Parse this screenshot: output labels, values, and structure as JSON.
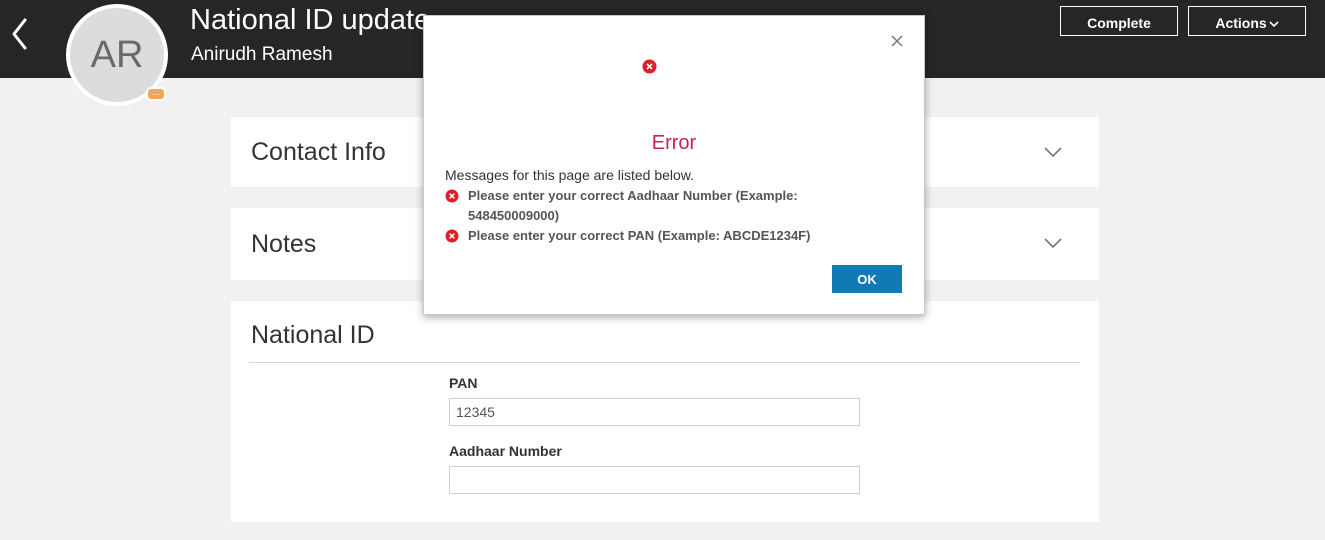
{
  "header": {
    "title": "National ID update",
    "subtitle": "Anirudh Ramesh",
    "avatar_initials": "AR",
    "avatar_badge": "…",
    "back_icon": "chevron-left-icon",
    "complete_label": "Complete",
    "actions_label": "Actions",
    "background_color": "#262626"
  },
  "sections": {
    "contact_title": "Contact Info",
    "notes_title": "Notes",
    "national_title": "National ID"
  },
  "form": {
    "pan_label": "PAN",
    "pan_value": "12345",
    "aadhaar_label": "Aadhaar Number",
    "aadhaar_value": ""
  },
  "dialog": {
    "title": "Error",
    "intro": "Messages for this page are listed below.",
    "messages": [
      "Please enter your correct Aadhaar Number (Example: 548450009000)",
      "Please enter your correct PAN (Example: ABCDE1234F)"
    ],
    "ok_label": "OK",
    "close_icon": "close-icon",
    "error_icon": "error-icon",
    "error_color": "#c7254e",
    "button_color": "#0f7ab5"
  }
}
